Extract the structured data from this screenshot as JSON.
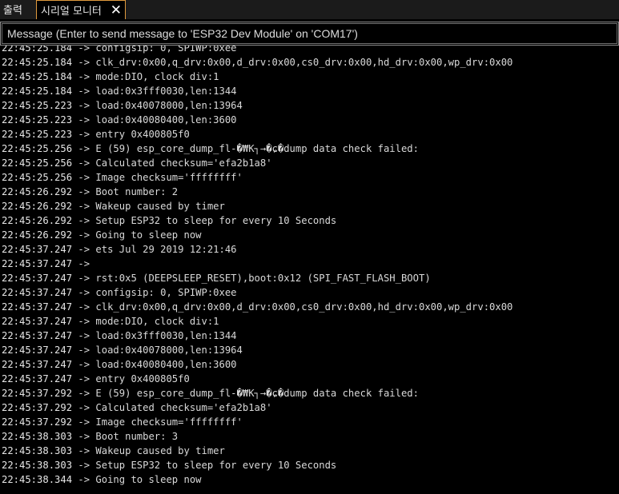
{
  "tabs": {
    "output_label": "출력",
    "serial_label": "시리얼 모니터",
    "close_glyph": "✕"
  },
  "message": {
    "placeholder": "Message (Enter to send message to 'ESP32 Dev Module' on 'COM17')"
  },
  "log": [
    {
      "ts": "22:45:25.184",
      "text": "configsip: 0, SPIWP:0xee"
    },
    {
      "ts": "22:45:25.184",
      "text": "clk_drv:0x00,q_drv:0x00,d_drv:0x00,cs0_drv:0x00,hd_drv:0x00,wp_drv:0x00"
    },
    {
      "ts": "22:45:25.184",
      "text": "mode:DIO, clock div:1"
    },
    {
      "ts": "22:45:25.184",
      "text": "load:0x3fff0030,len:1344"
    },
    {
      "ts": "22:45:25.223",
      "text": "load:0x40078000,len:13964"
    },
    {
      "ts": "22:45:25.223",
      "text": "load:0x40080400,len:3600"
    },
    {
      "ts": "22:45:25.223",
      "text": "entry 0x400805f0"
    },
    {
      "ts": "22:45:25.256",
      "text": "E (59) esp_core_dump_fl-�₩K┐→�ɕ�dump data check failed:"
    },
    {
      "ts": "22:45:25.256",
      "text": "Calculated checksum='efa2b1a8'"
    },
    {
      "ts": "22:45:25.256",
      "text": "Image checksum='ffffffff'"
    },
    {
      "ts": "22:45:26.292",
      "text": "Boot number: 2"
    },
    {
      "ts": "22:45:26.292",
      "text": "Wakeup caused by timer"
    },
    {
      "ts": "22:45:26.292",
      "text": "Setup ESP32 to sleep for every 10 Seconds"
    },
    {
      "ts": "22:45:26.292",
      "text": "Going to sleep now"
    },
    {
      "ts": "22:45:37.247",
      "text": "ets Jul 29 2019 12:21:46"
    },
    {
      "ts": "22:45:37.247",
      "text": ""
    },
    {
      "ts": "22:45:37.247",
      "text": "rst:0x5 (DEEPSLEEP_RESET),boot:0x12 (SPI_FAST_FLASH_BOOT)"
    },
    {
      "ts": "22:45:37.247",
      "text": "configsip: 0, SPIWP:0xee"
    },
    {
      "ts": "22:45:37.247",
      "text": "clk_drv:0x00,q_drv:0x00,d_drv:0x00,cs0_drv:0x00,hd_drv:0x00,wp_drv:0x00"
    },
    {
      "ts": "22:45:37.247",
      "text": "mode:DIO, clock div:1"
    },
    {
      "ts": "22:45:37.247",
      "text": "load:0x3fff0030,len:1344"
    },
    {
      "ts": "22:45:37.247",
      "text": "load:0x40078000,len:13964"
    },
    {
      "ts": "22:45:37.247",
      "text": "load:0x40080400,len:3600"
    },
    {
      "ts": "22:45:37.247",
      "text": "entry 0x400805f0"
    },
    {
      "ts": "22:45:37.292",
      "text": "E (59) esp_core_dump_fl-�₩K┐→�ɕ�dump data check failed:"
    },
    {
      "ts": "22:45:37.292",
      "text": "Calculated checksum='efa2b1a8'"
    },
    {
      "ts": "22:45:37.292",
      "text": "Image checksum='ffffffff'"
    },
    {
      "ts": "22:45:38.303",
      "text": "Boot number: 3"
    },
    {
      "ts": "22:45:38.303",
      "text": "Wakeup caused by timer"
    },
    {
      "ts": "22:45:38.303",
      "text": "Setup ESP32 to sleep for every 10 Seconds"
    },
    {
      "ts": "22:45:38.344",
      "text": "Going to sleep now"
    }
  ]
}
